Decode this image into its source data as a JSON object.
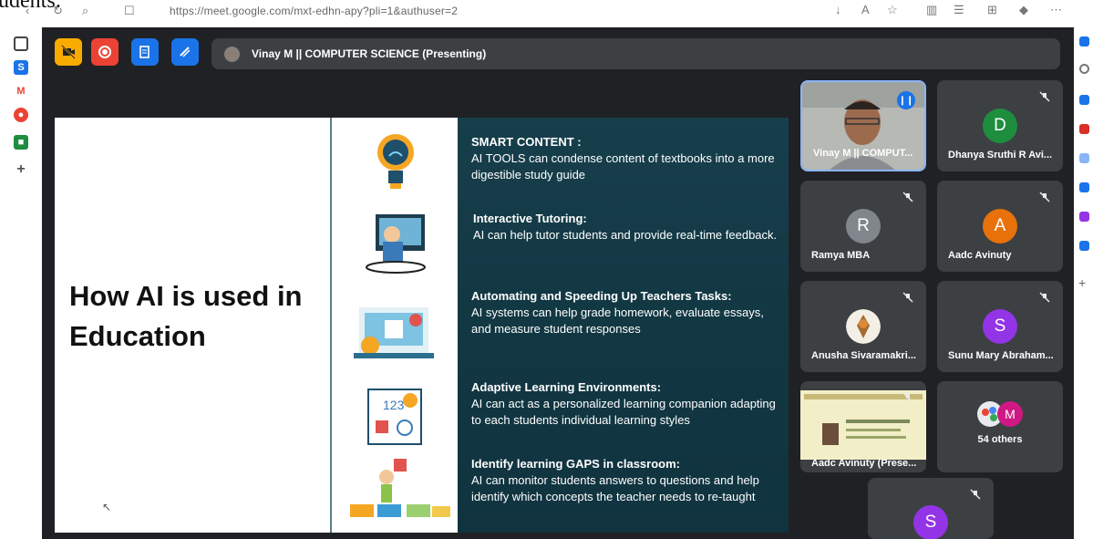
{
  "browser": {
    "url": "https://meet.google.com/mxt-edhn-apy?pli=1&authuser=2",
    "left_fragment": "udents:"
  },
  "meet": {
    "presenting_label": "Vinay M || COMPUTER SCIENCE (Presenting)",
    "toolbar": [
      {
        "icon": "camera-off-icon",
        "color": "#f9ab00"
      },
      {
        "icon": "record-icon",
        "color": "#ea4335"
      },
      {
        "icon": "notes-icon",
        "color": "#1a73e8"
      },
      {
        "icon": "whiteboard-icon",
        "color": "#1a73e8"
      }
    ]
  },
  "slide": {
    "title": "How AI is used in Education",
    "items": [
      {
        "heading": "SMART CONTENT :",
        "body": "AI TOOLS can condense  content of textbooks into a more digestible study guide"
      },
      {
        "heading": "Interactive Tutoring:",
        "body": "AI can help tutor students and provide real-time feedback."
      },
      {
        "heading": "Automating and Speeding Up Teachers Tasks:",
        "body": "AI systems can help grade homework, evaluate essays, and measure student responses"
      },
      {
        "heading": "Adaptive Learning Environments:",
        "body": "AI can act as a personalized learning companion adapting to each students individual learning styles"
      },
      {
        "heading": "Identify learning GAPS in classroom:",
        "body": "AI can monitor students answers to questions and help identify which concepts the teacher needs to re-taught"
      }
    ]
  },
  "participants": [
    {
      "name": "Vinay M || COMPUT...",
      "initial": "",
      "color": "#6b5b4f",
      "video": true,
      "speaking": true
    },
    {
      "name": "Dhanya Sruthi R Avi...",
      "initial": "D",
      "color": "#1e8e3e",
      "muted": true
    },
    {
      "name": "Ramya MBA",
      "initial": "R",
      "color": "#80868b",
      "muted": true
    },
    {
      "name": "Aadc Avinuty",
      "initial": "A",
      "color": "#e8710a",
      "muted": true
    },
    {
      "name": "Anusha Sivaramakri...",
      "initial": "",
      "color": "#a36b2c",
      "muted": true
    },
    {
      "name": "Sunu Mary Abraham...",
      "initial": "S",
      "color": "#9334e6",
      "muted": true
    },
    {
      "name": "Aadc Avinuty (Prese...",
      "initial": "",
      "color": "#d9d6a8",
      "muted": true
    },
    {
      "name": "54 others",
      "initial": "M",
      "color": "#d01884"
    },
    {
      "name": "",
      "initial": "S",
      "color": "#9334e6",
      "muted": true
    }
  ]
}
